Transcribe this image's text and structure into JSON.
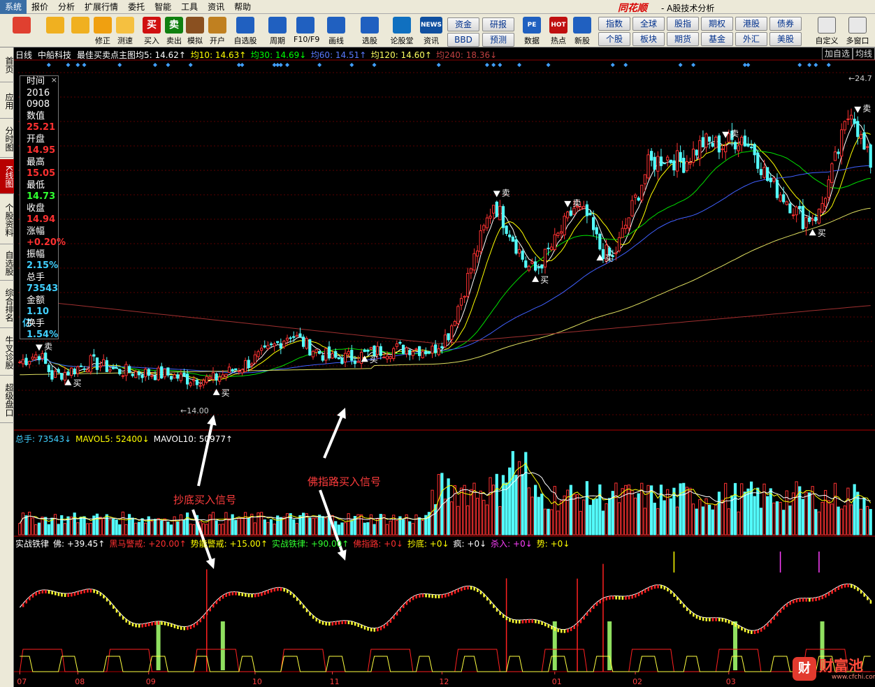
{
  "app": {
    "menu": [
      "系统",
      "报价",
      "分析",
      "扩展行情",
      "委托",
      "智能",
      "工具",
      "资讯",
      "帮助"
    ],
    "active_menu": 0,
    "brand": "同花顺",
    "brand_sub": "- A股技术分析"
  },
  "toolbar": {
    "buttons": [
      {
        "label": "",
        "icon": "color-block-icon",
        "color": "#e04030"
      },
      {
        "label": "",
        "icon": "back-arrow-icon",
        "color": "#f0b020"
      },
      {
        "label": "",
        "icon": "up-down-arrow-icon",
        "color": "#f0b020"
      },
      {
        "label": "修正",
        "icon": "coin-icon",
        "color": "#f0a010"
      },
      {
        "label": "测速",
        "icon": "clock-icon",
        "color": "#f5c040"
      },
      {
        "label": "买入",
        "icon": "buy-icon",
        "text": "买",
        "color": "#d01010"
      },
      {
        "label": "卖出",
        "icon": "sell-icon",
        "text": "卖",
        "color": "#108010"
      },
      {
        "label": "模拟",
        "icon": "hammer-icon",
        "color": "#8a5020"
      },
      {
        "label": "开户",
        "icon": "lock-icon",
        "color": "#c08020"
      },
      {
        "label": "自选股",
        "icon": "star-icon",
        "color": "#2060c0"
      },
      {
        "label": "周期",
        "icon": "cycle-icon",
        "color": "#2060c0"
      },
      {
        "label": "F10/F9",
        "icon": "f10-icon",
        "color": "#2060c0"
      },
      {
        "label": "画线",
        "icon": "pencil-icon",
        "color": "#2060c0"
      },
      {
        "label": "选股",
        "icon": "monitor-icon",
        "color": "#2060c0"
      },
      {
        "label": "论股堂",
        "icon": "forum-icon",
        "color": "#1070c0"
      },
      {
        "label": "资讯",
        "icon": "news-icon",
        "text": "NEWS",
        "color": "#1050a0"
      }
    ],
    "small_buttons": [
      "资金",
      "研报",
      "BBD",
      "预测"
    ],
    "mid_buttons": [
      {
        "label": "数据",
        "icon": "pe-icon",
        "text": "PE",
        "color": "#2060c0"
      },
      {
        "label": "热点",
        "icon": "hot-icon",
        "text": "HOT",
        "color": "#c01010"
      },
      {
        "label": "新股",
        "icon": "new-stock-icon",
        "color": "#2060c0"
      }
    ],
    "grid_buttons": [
      "指数",
      "全球",
      "股指",
      "期权",
      "港股",
      "债券",
      "个股",
      "板块",
      "期货",
      "基金",
      "外汇",
      "美股"
    ],
    "right_buttons": [
      {
        "label": "自定义",
        "icon": "custom-icon"
      },
      {
        "label": "多窗口",
        "icon": "multi-window-icon"
      }
    ]
  },
  "side_tabs": [
    "首页",
    "应用",
    "分时图",
    "K线图",
    "个股资料",
    "自选股",
    "综合排名",
    "牛叉诊股",
    "超级盘口"
  ],
  "active_side_tab": 3,
  "info_bar": {
    "period": "日线",
    "stock": "中船科技",
    "indicator": "最佳买卖点主图",
    "ma": [
      {
        "label": "均5: 14.62",
        "arrow": "↑",
        "color": "#ffffff"
      },
      {
        "label": "均10: 14.63",
        "arrow": "↑",
        "color": "#ffff00"
      },
      {
        "label": "均30: 14.69",
        "arrow": "↓",
        "color": "#00ff00"
      },
      {
        "label": "均60: 14.51",
        "arrow": "↑",
        "color": "#5a7aff"
      },
      {
        "label": "均120: 14.60",
        "arrow": "↑",
        "color": "#ffff60"
      },
      {
        "label": "均240: 18.36",
        "arrow": "↓",
        "color": "#c04040"
      }
    ],
    "right_tabs": [
      "加自选",
      "均线"
    ]
  },
  "data_window": [
    {
      "k": "时间",
      "v": ""
    },
    {
      "k": "2016",
      "v": "",
      "color": "#ffffff"
    },
    {
      "k": "0908",
      "v": "",
      "color": "#ffffff"
    },
    {
      "k": "数值",
      "v": ""
    },
    {
      "k": "",
      "v": "25.21",
      "color": "#ff3030"
    },
    {
      "k": "开盘",
      "v": ""
    },
    {
      "k": "",
      "v": "14.95",
      "color": "#ff3030"
    },
    {
      "k": "最高",
      "v": ""
    },
    {
      "k": "",
      "v": "15.05",
      "color": "#ff3030"
    },
    {
      "k": "最低",
      "v": ""
    },
    {
      "k": "",
      "v": "14.73",
      "color": "#30ff30"
    },
    {
      "k": "收盘",
      "v": ""
    },
    {
      "k": "",
      "v": "14.94",
      "color": "#ff3030"
    },
    {
      "k": "涨幅",
      "v": ""
    },
    {
      "k": "",
      "v": "+0.20%",
      "color": "#ff3030"
    },
    {
      "k": "振幅",
      "v": ""
    },
    {
      "k": "",
      "v": "2.15%",
      "color": "#40d0ff"
    },
    {
      "k": "总手",
      "v": ""
    },
    {
      "k": "",
      "v": "73543",
      "color": "#40d0ff"
    },
    {
      "k": "金额",
      "v": ""
    },
    {
      "k": "",
      "v": "1.10亿",
      "color": "#40d0ff"
    },
    {
      "k": "换手",
      "v": ""
    },
    {
      "k": "",
      "v": "1.54%",
      "color": "#40d0ff"
    }
  ],
  "volume_legend": [
    {
      "text": "总手: 73543",
      "arrow": "↓",
      "color": "#40d0ff"
    },
    {
      "text": "MAVOL5: 52400",
      "arrow": "↓",
      "color": "#ffff00"
    },
    {
      "text": "MAVOL10: 50977",
      "arrow": "↑",
      "color": "#ffffff"
    }
  ],
  "signal_legend": [
    {
      "text": "实战铁律",
      "color": "#ffffff"
    },
    {
      "text": "佛: +39.45",
      "arrow": "↑",
      "color": "#ffffff"
    },
    {
      "text": "黑马警戒: +20.00",
      "arrow": "↑",
      "color": "#ff3030"
    },
    {
      "text": "势能警戒: +15.00",
      "arrow": "↑",
      "color": "#ffff00"
    },
    {
      "text": "实战铁律: +90.00",
      "arrow": "↑",
      "color": "#30ff30"
    },
    {
      "text": "佛指路: +0",
      "arrow": "↓",
      "color": "#ff3030"
    },
    {
      "text": "抄底: +0",
      "arrow": "↓",
      "color": "#ffff00"
    },
    {
      "text": "疯: +0",
      "arrow": "↓",
      "color": "#ffffff"
    },
    {
      "text": "杀入: +0",
      "arrow": "↓",
      "color": "#ff40ff"
    },
    {
      "text": "势: +0",
      "arrow": "↓",
      "color": "#ffff00"
    }
  ],
  "annotations": [
    "抄底买入信号",
    "佛指路买入信号"
  ],
  "price_labels": {
    "low": "14.00",
    "high": "24.7"
  },
  "signals": {
    "buy": "买",
    "sell": "卖"
  },
  "watermark": {
    "logo": "财",
    "text": "财富池",
    "url": "www.cfchi.com"
  },
  "chart_data": {
    "type": "candlestick",
    "x_ticks": [
      {
        "label": "07",
        "i": 0
      },
      {
        "label": "08",
        "i": 18
      },
      {
        "label": "09",
        "i": 40
      },
      {
        "label": "10",
        "i": 73
      },
      {
        "label": "11",
        "i": 97
      },
      {
        "label": "12",
        "i": 131
      },
      {
        "label": "01",
        "i": 166
      },
      {
        "label": "02",
        "i": 191
      },
      {
        "label": "03",
        "i": 220
      }
    ],
    "anchors": [
      [
        0,
        14.6
      ],
      [
        6,
        14.9
      ],
      [
        10,
        14.1
      ],
      [
        16,
        14.3
      ],
      [
        22,
        14.6
      ],
      [
        30,
        14.3
      ],
      [
        40,
        14.2
      ],
      [
        46,
        14.15
      ],
      [
        52,
        14.0
      ],
      [
        60,
        14.0
      ],
      [
        68,
        14.4
      ],
      [
        76,
        14.9
      ],
      [
        84,
        15.6
      ],
      [
        90,
        15.1
      ],
      [
        97,
        14.7
      ],
      [
        105,
        14.8
      ],
      [
        112,
        15.0
      ],
      [
        120,
        15.1
      ],
      [
        128,
        15.0
      ],
      [
        133,
        15.6
      ],
      [
        138,
        17.2
      ],
      [
        142,
        18.6
      ],
      [
        147,
        20.2
      ],
      [
        152,
        19.2
      ],
      [
        157,
        18.0
      ],
      [
        160,
        17.8
      ],
      [
        166,
        18.8
      ],
      [
        172,
        20.0
      ],
      [
        176,
        19.7
      ],
      [
        180,
        18.6
      ],
      [
        184,
        18.2
      ],
      [
        190,
        20.0
      ],
      [
        195,
        21.5
      ],
      [
        200,
        21.8
      ],
      [
        206,
        21.6
      ],
      [
        212,
        22.3
      ],
      [
        218,
        22.2
      ],
      [
        224,
        22.5
      ],
      [
        228,
        22.0
      ],
      [
        232,
        21.0
      ],
      [
        238,
        20.3
      ],
      [
        243,
        19.6
      ],
      [
        248,
        19.8
      ],
      [
        254,
        22.0
      ],
      [
        258,
        23.6
      ],
      [
        262,
        22.0
      ],
      [
        264,
        21.6
      ]
    ],
    "buy_points": [
      15,
      61,
      107,
      160,
      180,
      246
    ],
    "sell_points": [
      6,
      148,
      170,
      219,
      260
    ],
    "y_range": [
      12.6,
      25.0
    ],
    "series_ma": [
      "5",
      "10",
      "30",
      "60",
      "120",
      "240"
    ]
  }
}
